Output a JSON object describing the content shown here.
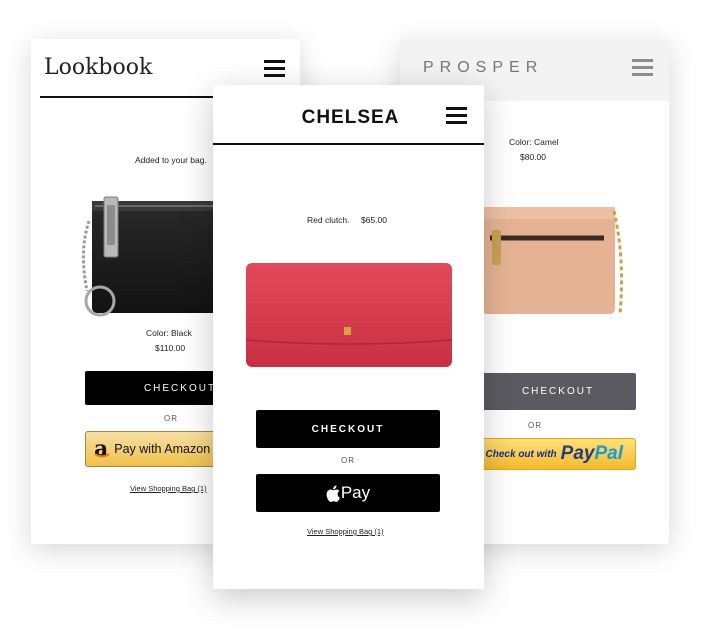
{
  "lookbook": {
    "brand": "Lookbook",
    "added_text": "Added to your bag.",
    "color_text": "Color: Black",
    "price": "$110.00",
    "checkout_label": "CHECKOUT",
    "or_label": "OR",
    "amazon_label": "Pay with Amazon",
    "view_bag_label": "View Shopping Bag (1)"
  },
  "chelsea": {
    "brand": "CHELSEA",
    "product_name": "Red clutch.",
    "price": "$65.00",
    "checkout_label": "CHECKOUT",
    "or_label": "OR",
    "applepay_label": "Pay",
    "view_bag_label": "View Shopping Bag (1)"
  },
  "prosper": {
    "brand": "PROSPER",
    "color_text": "Color: Camel",
    "price": "$80.00",
    "checkout_label": "CHECKOUT",
    "or_label": "OR",
    "paypal_prefix": "Check out with",
    "paypal_pay": "Pay",
    "paypal_pal": "Pal"
  },
  "colors": {
    "black_button": "#000000",
    "prosper_button": "#5c5a61",
    "clutch_red": "#d9394b",
    "wallet_black": "#1d1d1d",
    "camel": "#e7b595",
    "amazon_yellow": "#f0c14b",
    "paypal_yellow": "#fcc439"
  }
}
